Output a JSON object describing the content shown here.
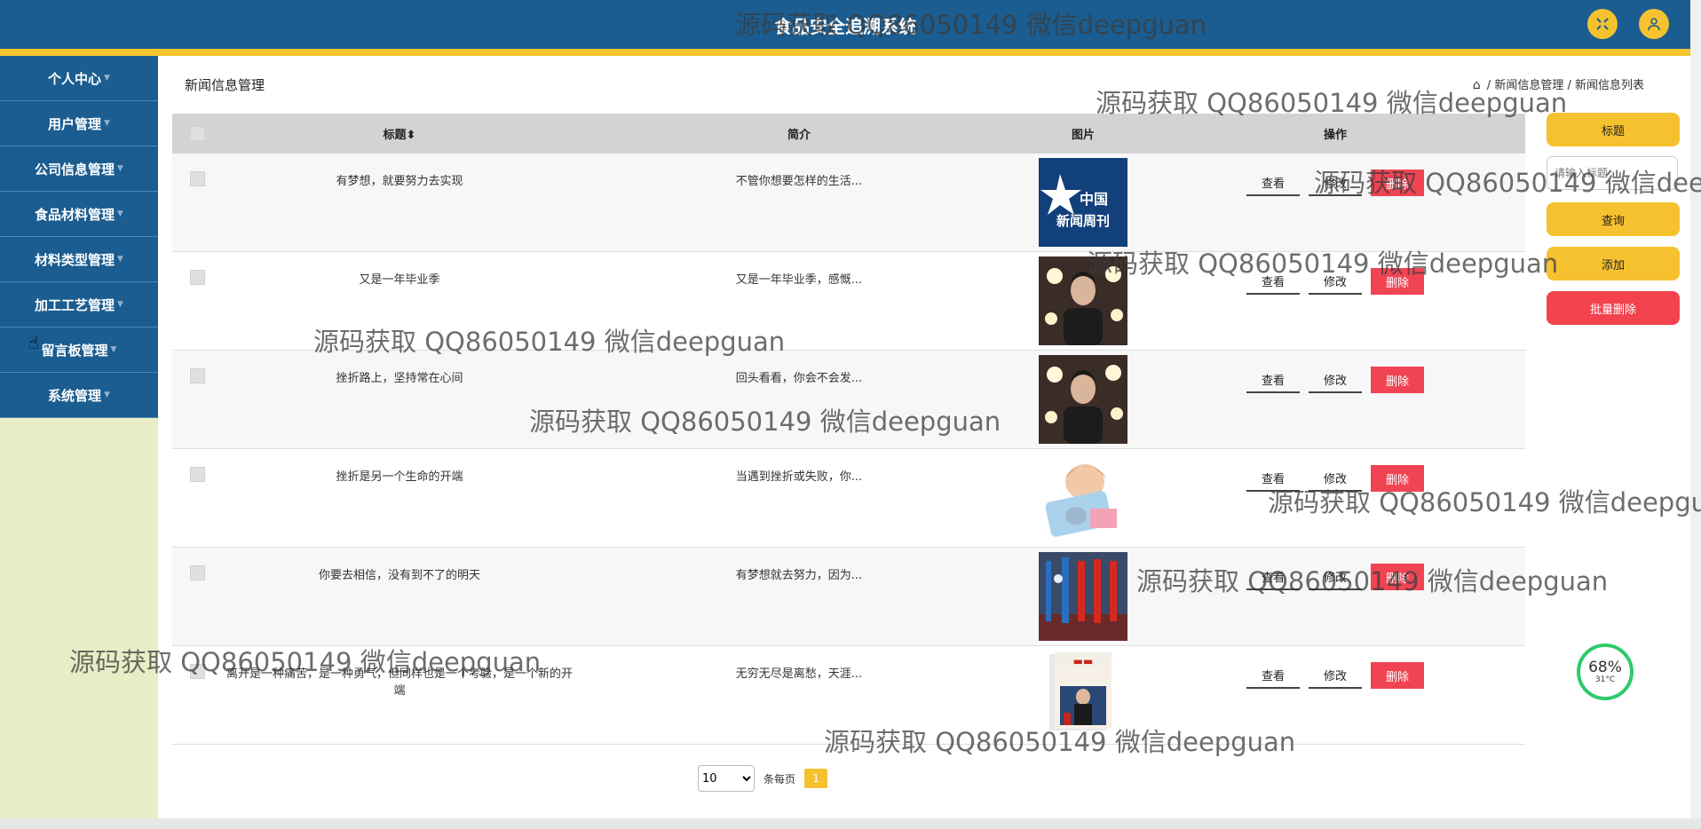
{
  "header": {
    "title": "食品安全追溯系统"
  },
  "sidebar": {
    "items": [
      {
        "label": "个人中心"
      },
      {
        "label": "用户管理"
      },
      {
        "label": "公司信息管理"
      },
      {
        "label": "食品材料管理"
      },
      {
        "label": "材料类型管理"
      },
      {
        "label": "加工工艺管理"
      },
      {
        "label": "留言板管理"
      },
      {
        "label": "系统管理"
      }
    ]
  },
  "page": {
    "heading": "新闻信息管理",
    "breadcrumb": [
      "新闻信息管理",
      "新闻信息列表"
    ]
  },
  "table": {
    "headers": {
      "title": "标题",
      "intro": "简介",
      "image": "图片",
      "ops": "操作"
    },
    "rows": [
      {
        "title": "有梦想，就要努力去实现",
        "intro": "不管你想要怎样的生活..."
      },
      {
        "title": "又是一年毕业季",
        "intro": "又是一年毕业季，感慨..."
      },
      {
        "title": "挫折路上，坚持常在心间",
        "intro": "回头看看，你会不会发..."
      },
      {
        "title": "挫折是另一个生命的开端",
        "intro": "当遇到挫折或失败，你..."
      },
      {
        "title": "你要去相信，没有到不了的明天",
        "intro": "有梦想就去努力，因为..."
      },
      {
        "title": "离开是一种痛苦，是一种勇气，但同样也是一个考验，是一个新的开端",
        "intro": "无穷无尽是离愁，天涯..."
      }
    ],
    "ops": {
      "view": "查看",
      "edit": "修改",
      "delete": "删除"
    }
  },
  "side_panel": {
    "title_btn": "标题",
    "search_placeholder": "请输入标题",
    "query_btn": "查询",
    "add_btn": "添加",
    "batch_delete_btn": "批量删除"
  },
  "pagination": {
    "page_size": "10",
    "per_page_label": "条每页",
    "current_page": "1"
  },
  "gauge": {
    "percent": "68%",
    "temp": "31°C"
  },
  "logo_text": {
    "line1": "中国",
    "line2": "新闻周刊"
  },
  "watermark": "源码获取 QQ86050149 微信deepguan",
  "colors": {
    "primary": "#1b5d90",
    "accent": "#f7c52f",
    "danger": "#f04453",
    "sidebar_bg": "#e8edc6"
  }
}
